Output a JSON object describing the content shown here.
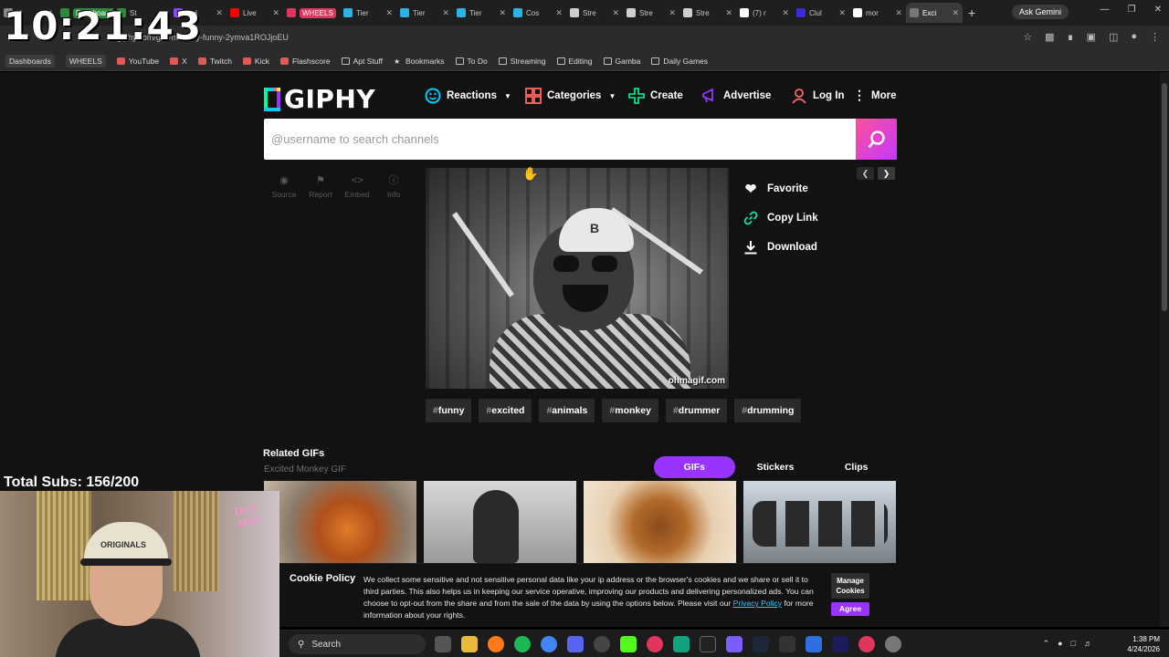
{
  "overlay": {
    "clock": "10:21:43",
    "subs": "Total Subs: 156/200",
    "webcam_cap_text": "ORIGINALS",
    "webcam_neon": "Dirty Mike"
  },
  "browser": {
    "tabs": [
      {
        "label": "N",
        "color": "#888888"
      },
      {
        "label": "Dashboards",
        "color": "#2c8a3c",
        "style": "pill2"
      },
      {
        "label": "St",
        "color": "#2c8a3c"
      },
      {
        "label": "Twi",
        "color": "#9146ff"
      },
      {
        "label": "Live",
        "color": "#ff0000"
      },
      {
        "label": "WHEELS",
        "color": "#e0355d",
        "style": "pill"
      },
      {
        "label": "Tier",
        "color": "#2bb3e8"
      },
      {
        "label": "Tier",
        "color": "#2bb3e8"
      },
      {
        "label": "Tier",
        "color": "#2bb3e8"
      },
      {
        "label": "Cos",
        "color": "#2bb3e8"
      },
      {
        "label": "Stre",
        "color": "#cfcfcf"
      },
      {
        "label": "Stre",
        "color": "#cfcfcf"
      },
      {
        "label": "Stre",
        "color": "#cfcfcf"
      },
      {
        "label": "(7) r",
        "color": "#ffffff"
      },
      {
        "label": "Clul",
        "color": "#3b2bd8"
      },
      {
        "label": "mor",
        "color": "#ffffff"
      },
      {
        "label": "Exci",
        "color": "#777777",
        "active": true
      }
    ],
    "new_tab": "+",
    "ask_gemini": "Ask Gemini",
    "url": "giphy.com/gifs/monkey-funny-2ymva1ROJjoEU",
    "bookmarks": [
      {
        "label": "Dashboards",
        "type": "chip"
      },
      {
        "label": "WHEELS",
        "type": "chip"
      },
      {
        "label": "YouTube",
        "type": "link"
      },
      {
        "label": "X",
        "type": "link"
      },
      {
        "label": "Twitch",
        "type": "link"
      },
      {
        "label": "Kick",
        "type": "link"
      },
      {
        "label": "Flashscore",
        "type": "link"
      },
      {
        "label": "Apt Stuff",
        "type": "folder"
      },
      {
        "label": "Bookmarks",
        "type": "star"
      },
      {
        "label": "To Do",
        "type": "folder"
      },
      {
        "label": "Streaming",
        "type": "folder"
      },
      {
        "label": "Editing",
        "type": "folder"
      },
      {
        "label": "Gamba",
        "type": "folder"
      },
      {
        "label": "Daily Games",
        "type": "folder"
      }
    ]
  },
  "giphy": {
    "logo": "GIPHY",
    "nav": {
      "reactions": "Reactions",
      "categories": "Categories",
      "create": "Create",
      "advertise": "Advertise",
      "login": "Log In",
      "more": "More"
    },
    "search": {
      "placeholder": "@username to search channels",
      "value": ""
    },
    "tools": {
      "source": "Source",
      "report": "Report",
      "embed": "Embed",
      "info": "Info"
    },
    "gif": {
      "watermark": "ohmagif.com",
      "hat_letter": "B"
    },
    "actions": {
      "favorite": "Favorite",
      "copy_link": "Copy Link",
      "download": "Download"
    },
    "tags": [
      "funny",
      "excited",
      "animals",
      "monkey",
      "drummer",
      "drumming"
    ],
    "related": {
      "title": "Related GIFs",
      "subtitle": "Excited Monkey GIF",
      "tabs": {
        "gifs": "GIFs",
        "stickers": "Stickers",
        "clips": "Clips"
      }
    },
    "cookie": {
      "title": "Cookie Policy",
      "body": "We collect some sensitive and not sensitive personal data like your ip address or the browser's cookies and we share or sell it to third parties. This also helps us in keeping our service operative, improving our products and delivering personalized ads. You can choose to opt-out from the share and from the sale of the data by using the options below. Please visit our ",
      "link": "Privacy Policy",
      "tail": " for more information about your rights.",
      "manage": "Manage Cookies",
      "agree": "Agree"
    }
  },
  "taskbar": {
    "search": "Search",
    "time": "1:38 PM",
    "date": "4/24/2026"
  },
  "colors": {
    "accent_purple": "#9933ff",
    "search_gradient_start": "#ff4f9a",
    "search_gradient_end": "#c438ff",
    "copy_link_green": "#00e6a8"
  }
}
